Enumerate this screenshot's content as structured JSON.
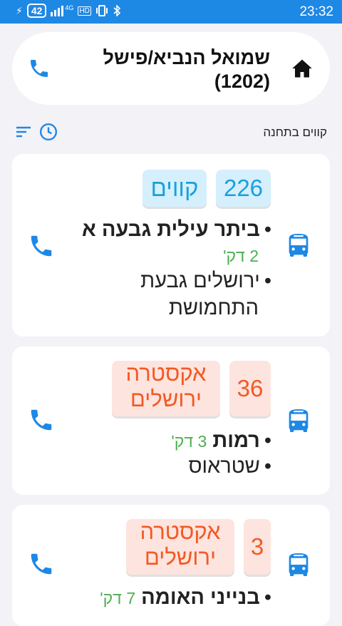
{
  "status": {
    "battery": "42",
    "network": "4G",
    "hd": "HD",
    "time": "23:32"
  },
  "stop": {
    "title_line1": "שמואל הנביא/פישל",
    "title_line2": "(1202)"
  },
  "section": {
    "title": "קווים בתחנה"
  },
  "colors": {
    "accent": "#1e88e5",
    "blue_badge_bg": "#d5effc",
    "blue_badge_text": "#1aa0dc",
    "orange_badge_bg": "#fde4de",
    "orange_badge_text": "#f25a24",
    "eta": "#4caf50"
  },
  "cards": [
    {
      "line": "226",
      "operator": "קווים",
      "dest1": "ביתר עילית גבעה א",
      "eta1": "2 דק'",
      "dest2_line1": "ירושלים גבעת",
      "dest2_line2": "התחמושת"
    },
    {
      "line": "36",
      "operator_line1": "אקסטרה",
      "operator_line2": "ירושלים",
      "dest1": "רמות",
      "eta1": "3 דק'",
      "dest2": "שטראוס"
    },
    {
      "line": "3",
      "operator_line1": "אקסטרה",
      "operator_line2": "ירושלים",
      "dest1": "בנייני האומה",
      "eta1": "7 דק'"
    }
  ]
}
